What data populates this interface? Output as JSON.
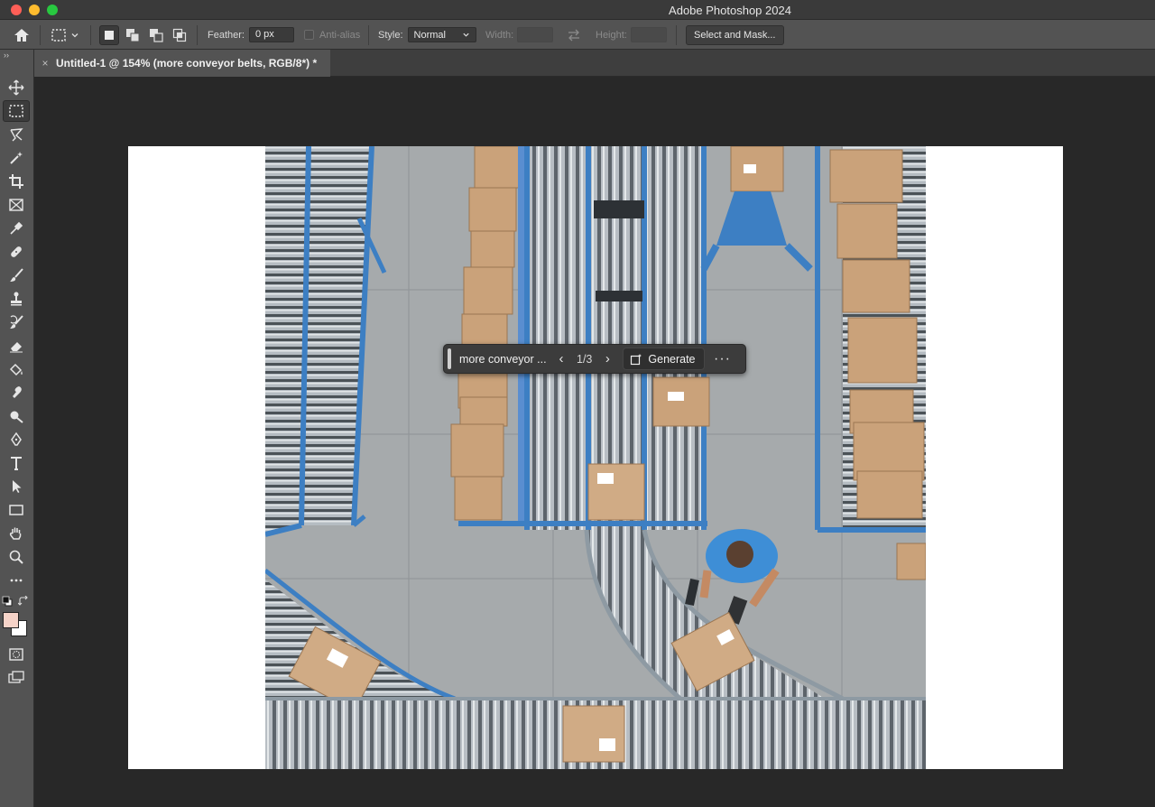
{
  "app": {
    "title": "Adobe Photoshop 2024"
  },
  "options_bar": {
    "feather_label": "Feather:",
    "feather_value": "0 px",
    "antialias_label": "Anti-alias",
    "style_label": "Style:",
    "style_value": "Normal",
    "width_label": "Width:",
    "height_label": "Height:",
    "select_mask_label": "Select and Mask..."
  },
  "document": {
    "tab_title": "Untitled-1 @ 154% (more conveyor belts, RGB/8*) *",
    "close_glyph": "×"
  },
  "generative_bar": {
    "prompt": "more conveyor ...",
    "prev_glyph": "‹",
    "counter": "1/3",
    "next_glyph": "›",
    "generate_label": "Generate",
    "more_glyph": "···"
  },
  "tools": [
    {
      "name": "move-tool-icon"
    },
    {
      "name": "rectangular-marquee-tool-icon",
      "active": true
    },
    {
      "name": "lasso-tool-icon"
    },
    {
      "name": "magic-wand-tool-icon"
    },
    {
      "name": "crop-tool-icon"
    },
    {
      "name": "frame-tool-icon"
    },
    {
      "name": "eyedropper-tool-icon"
    },
    {
      "name": "healing-brush-tool-icon"
    },
    {
      "name": "brush-tool-icon"
    },
    {
      "name": "clone-stamp-tool-icon"
    },
    {
      "name": "history-brush-tool-icon"
    },
    {
      "name": "eraser-tool-icon"
    },
    {
      "name": "paint-bucket-tool-icon"
    },
    {
      "name": "smudge-tool-icon"
    },
    {
      "name": "dodge-tool-icon"
    },
    {
      "name": "pen-tool-icon"
    },
    {
      "name": "type-tool-icon"
    },
    {
      "name": "path-selection-tool-icon"
    },
    {
      "name": "rectangle-tool-icon"
    },
    {
      "name": "hand-tool-icon"
    },
    {
      "name": "zoom-tool-icon"
    },
    {
      "name": "more-tools-icon"
    }
  ],
  "colors": {
    "foreground": "#f6d3c8",
    "background": "#ffffff",
    "conveyor_frame": "#3d7fc3",
    "box": "#c9a27a",
    "floor": "#a7aaab"
  }
}
